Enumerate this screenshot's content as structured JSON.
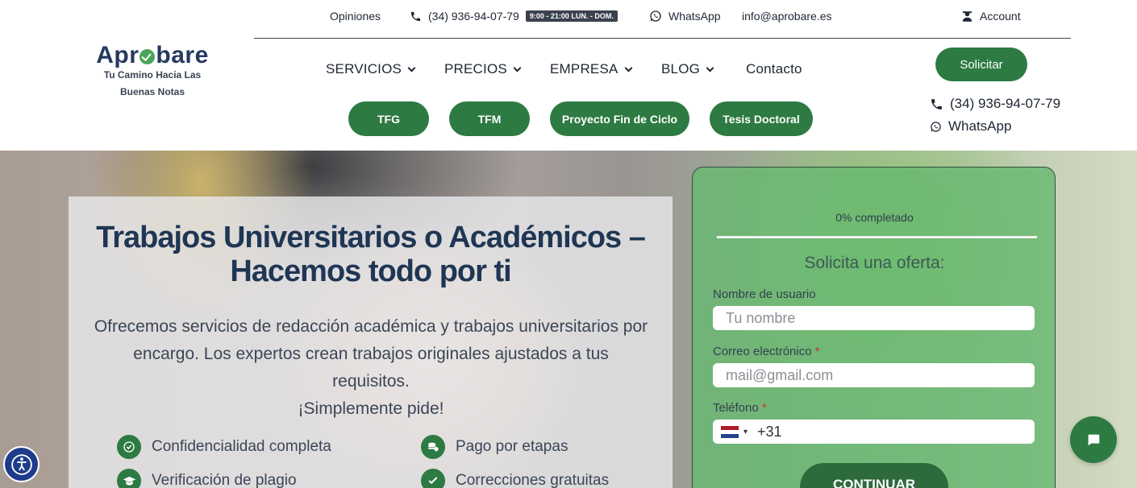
{
  "topbar": {
    "reviews": "Opiniones",
    "phone": "(34) 936-94-07-79",
    "hours_badge": "9:00 - 21:00 LUN. - DOM.",
    "whatsapp": "WhatsApp",
    "email": "info@aprobare.es",
    "account": "Account"
  },
  "logo": {
    "word_start": "Apr",
    "word_end": "bare",
    "tagline_line1": "Tu Camino Hacia Las",
    "tagline_line2": "Buenas Notas"
  },
  "nav": {
    "items": [
      {
        "label": "SERVICIOS",
        "has_dropdown": true
      },
      {
        "label": "PRECIOS",
        "has_dropdown": true
      },
      {
        "label": "EMPRESA",
        "has_dropdown": true
      },
      {
        "label": "BLOG",
        "has_dropdown": true
      },
      {
        "label": "Contacto",
        "has_dropdown": false
      }
    ],
    "cta": "Solicitar"
  },
  "quick_links": [
    "TFG",
    "TFM",
    "Proyecto Fin de Ciclo",
    "Tesis Doctoral"
  ],
  "side_contact": {
    "phone": "(34) 936-94-07-79",
    "whatsapp": "WhatsApp"
  },
  "hero": {
    "title_line1": "Trabajos Universitarios o Académicos –",
    "title_line2": "Hacemos todo por ti",
    "desc_line1": "Ofrecemos servicios de redacción académica y trabajos universitarios por",
    "desc_line2": "encargo. Los expertos crean trabajos originales ajustados a tus requisitos.",
    "desc_line3": "¡Simplemente pide!",
    "features": [
      {
        "label": "Confidencialidad completa",
        "icon": "check-icon"
      },
      {
        "label": "Pago por etapas",
        "icon": "coins-icon"
      },
      {
        "label": "Verificación de plagio",
        "icon": "graduation-cap-icon"
      },
      {
        "label": "Correcciones gratuitas",
        "icon": "check-icon"
      }
    ]
  },
  "form": {
    "progress_text": "0% completado",
    "progress": 0,
    "title": "Solicita una oferta:",
    "name_label": "Nombre de usuario",
    "name_placeholder": "Tu nombre",
    "email_label": "Correo electrónico",
    "email_placeholder": "mail@gmail.com",
    "phone_label": "Teléfono",
    "phone_value": "+31",
    "required_mark": "*",
    "continue_label": "CONTINUAR"
  },
  "colors": {
    "brand_green": "#2d7a43",
    "navy": "#1f3654"
  }
}
